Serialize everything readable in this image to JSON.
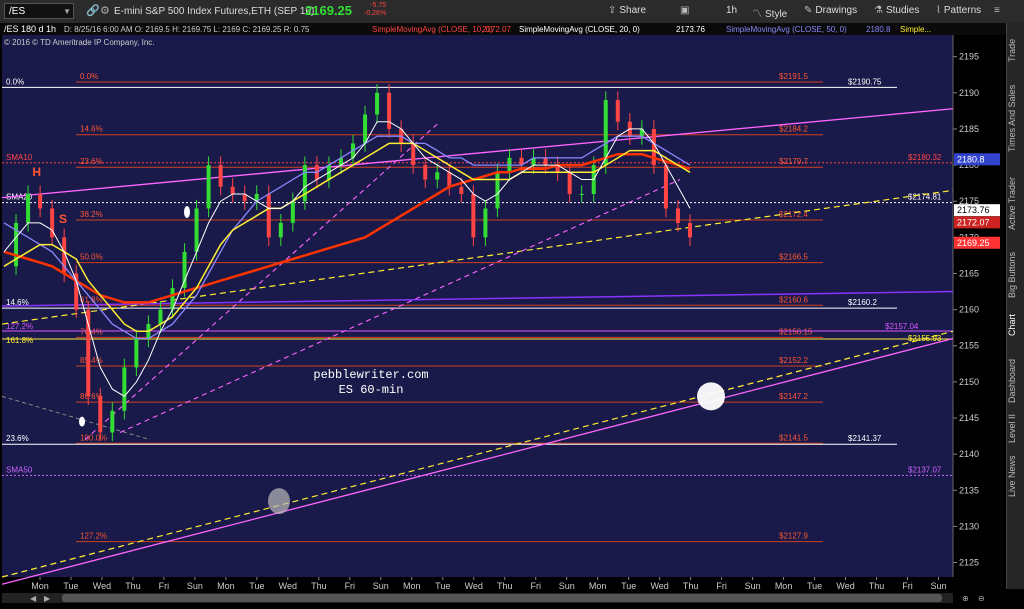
{
  "toolbar": {
    "symbol": "/ES",
    "title": "E-mini S&P 500 Index Futures,ETH (SEP 16)",
    "price": "2169.25",
    "change": "-5.75",
    "change_pct": "-0.26%",
    "share": "Share",
    "interval": "1h",
    "style": "Style",
    "drawings": "Drawings",
    "studies": "Studies",
    "patterns": "Patterns"
  },
  "info_bar": {
    "chart_id": "/ES 180 d 1h",
    "copyright": "© 2016 © TD Ameritrade IP Company, Inc.",
    "ohlc": "D: 8/25/16 6:00 AM  O: 2169.5  H: 2169.75  L: 2169  C: 2169.25  R: 0.75",
    "sma10_label": "SimpleMovingAvg (CLOSE, 10, 0)",
    "sma10_value": "2172.07",
    "sma20_label": "SimpleMovingAvg (CLOSE, 20, 0)",
    "sma20_value": "2173.76",
    "sma50_label": "SimpleMovingAvg (CLOSE, 50, 0)",
    "sma50_value": "2180.8",
    "more": "Simple..."
  },
  "side_tabs": [
    "Trade",
    "Times And Sales",
    "Active Trader",
    "Big Buttons",
    "Chart",
    "Dashboard",
    "Level II",
    "Live News"
  ],
  "colors": {
    "background": "#1a1a4a",
    "fib_line": "#d04020",
    "sma10": "#ffffff",
    "sma20": "#ffee33",
    "sma50": "#8888ff",
    "sma_long": "#ff3300",
    "trend_magenta": "#ff66ff",
    "trend_yellow": "#ffee33",
    "price_up": "#33dd33",
    "price_down": "#ff4444"
  },
  "chart_data": {
    "type": "line",
    "title": "pebblewriter.com",
    "subtitle": "ES 60-min",
    "ylim": [
      2123,
      2198
    ],
    "y_ticks": [
      2125,
      2130,
      2135,
      2140,
      2145,
      2150,
      2155,
      2160,
      2165,
      2170,
      2175,
      2180,
      2185,
      2190,
      2195
    ],
    "x_labels": [
      "Mon",
      "Tue",
      "Wed",
      "Thu",
      "Fri",
      "Sun",
      "Mon",
      "Tue",
      "Wed",
      "Thu",
      "Fri",
      "Sun",
      "Mon",
      "Tue",
      "Wed",
      "Thu",
      "Fri",
      "Sun",
      "Mon",
      "Tue",
      "Wed",
      "Thu",
      "Fri",
      "Sun",
      "Mon",
      "Tue",
      "Wed",
      "Thu",
      "Fri",
      "Sun"
    ],
    "fib_levels": [
      {
        "pct": "0.0%",
        "price": "$2191.5",
        "y": 2191.5
      },
      {
        "pct": "14.6%",
        "price": "$2184.2",
        "y": 2184.2
      },
      {
        "pct": "23.6%",
        "price": "$2179.7",
        "y": 2179.7
      },
      {
        "pct": "38.2%",
        "price": "$2172.4",
        "y": 2172.4
      },
      {
        "pct": "50.0%",
        "price": "$2166.5",
        "y": 2166.5
      },
      {
        "pct": "61.8%",
        "price": "$2160.6",
        "y": 2160.6
      },
      {
        "pct": "76.4%",
        "price": "$2156.15",
        "y": 2156.15
      },
      {
        "pct": "85.4%",
        "price": "$2152.2",
        "y": 2152.2
      },
      {
        "pct": "88.6%",
        "price": "$2147.2",
        "y": 2147.2
      },
      {
        "pct": "100.0%",
        "price": "$2141.5",
        "y": 2141.5
      },
      {
        "pct": "127.2%",
        "price": "$2127.9",
        "y": 2127.9
      }
    ],
    "white_levels": [
      {
        "left_label": "0.0%",
        "price": "$2190.75",
        "y": 2190.75
      },
      {
        "left_label": "14.6%",
        "price": "$2160.2",
        "y": 2160.2
      },
      {
        "left_label": "23.6%",
        "price": "$2141.37",
        "y": 2141.37
      }
    ],
    "dashed_levels": [
      {
        "label": "SMA10",
        "price": "$2180.32",
        "y": 2180.32,
        "color": "#ff4444"
      },
      {
        "label": "SMA20",
        "price": "$2174.81",
        "y": 2174.81,
        "color": "#ffffff"
      },
      {
        "label": "SMA50",
        "price": "$2137.07",
        "y": 2137.07,
        "color": "#cc66ff"
      }
    ],
    "extra_levels": [
      {
        "label": "127.2%",
        "price": "$2157.04",
        "y": 2157.04,
        "color": "#dd55ff"
      },
      {
        "label": "161.8%",
        "price": "$2155.93",
        "y": 2155.93,
        "color": "#ffee33"
      }
    ],
    "price_tags": [
      {
        "value": "2180.8",
        "y": 2180.8,
        "bg": "#3344cc",
        "fg": "#ffffff"
      },
      {
        "value": "2173.76",
        "y": 2173.76,
        "bg": "#ffffff",
        "fg": "#000000"
      },
      {
        "value": "2172.07",
        "y": 2172.07,
        "bg": "#cc2222",
        "fg": "#ffffff"
      },
      {
        "value": "2169.25",
        "y": 2169.25,
        "bg": "#ff3333",
        "fg": "#ffffff"
      }
    ],
    "pattern_labels": [
      {
        "text": "H",
        "x": 0.032,
        "y": 2178.5
      },
      {
        "text": "S",
        "x": 0.06,
        "y": 2172.0
      }
    ],
    "close_series": [
      2166,
      2172,
      2176,
      2174,
      2170,
      2165,
      2160,
      2148,
      2143,
      2146,
      2152,
      2156,
      2158,
      2160,
      2163,
      2168,
      2174,
      2180,
      2177,
      2176,
      2175,
      2176,
      2170,
      2172,
      2175,
      2180,
      2178,
      2180,
      2181,
      2183,
      2187,
      2190,
      2185,
      2183,
      2180,
      2178,
      2179,
      2177,
      2176,
      2170,
      2174,
      2179,
      2181,
      2180,
      2181,
      2180,
      2179,
      2176,
      2176,
      2180,
      2189,
      2186,
      2184,
      2185,
      2180,
      2174,
      2172,
      2170
    ],
    "sma10_series": [
      2168,
      2170,
      2172,
      2172,
      2171,
      2168,
      2164,
      2158,
      2152,
      2149,
      2148,
      2150,
      2153,
      2157,
      2160,
      2164,
      2168,
      2172,
      2175,
      2176,
      2176,
      2175,
      2174,
      2174,
      2175,
      2177,
      2178,
      2179,
      2180,
      2181,
      2183,
      2186,
      2186,
      2185,
      2183,
      2181,
      2180,
      2179,
      2178,
      2176,
      2175,
      2176,
      2178,
      2179,
      2180,
      2180,
      2180,
      2179,
      2178,
      2178,
      2181,
      2184,
      2185,
      2185,
      2183,
      2180,
      2177,
      2174
    ],
    "sma20_series": [
      2166,
      2167,
      2168,
      2169,
      2169,
      2168,
      2167,
      2164,
      2162,
      2160,
      2158,
      2157,
      2157,
      2158,
      2159,
      2161,
      2163,
      2166,
      2169,
      2171,
      2172,
      2173,
      2174,
      2174,
      2175,
      2176,
      2177,
      2178,
      2179,
      2180,
      2181,
      2182,
      2183,
      2183,
      2183,
      2182,
      2181,
      2180,
      2179,
      2178,
      2178,
      2178,
      2178,
      2179,
      2179,
      2179,
      2179,
      2179,
      2179,
      2179,
      2180,
      2181,
      2182,
      2182,
      2182,
      2181,
      2180,
      2179
    ],
    "sma50_series": [
      2172,
      2171,
      2170,
      2169,
      2168,
      2166,
      2164,
      2162,
      2160,
      2158,
      2157,
      2156,
      2156,
      2157,
      2158,
      2160,
      2162,
      2165,
      2168,
      2171,
      2173,
      2175,
      2176,
      2177,
      2178,
      2179,
      2179,
      2180,
      2181,
      2182,
      2183,
      2184,
      2184,
      2184,
      2183,
      2183,
      2182,
      2181,
      2181,
      2180,
      2180,
      2180,
      2180,
      2180,
      2181,
      2181,
      2181,
      2181,
      2181,
      2182,
      2183,
      2184,
      2184,
      2184,
      2183,
      2182,
      2181,
      2180
    ],
    "sma_long_series": [
      2168,
      2167.5,
      2167,
      2166.5,
      2166,
      2165,
      2164,
      2163,
      2162,
      2161.5,
      2161,
      2161,
      2161,
      2161.5,
      2162,
      2162.5,
      2163,
      2163.5,
      2164,
      2164.5,
      2165,
      2165.5,
      2166,
      2166.5,
      2167,
      2167.5,
      2168,
      2168.5,
      2169,
      2169.5,
      2170,
      2171,
      2172,
      2173,
      2174,
      2175,
      2176,
      2177,
      2177.5,
      2178,
      2178.5,
      2179,
      2179,
      2179.5,
      2179.5,
      2179.5,
      2180,
      2180,
      2180,
      2180.5,
      2181,
      2181.5,
      2181.5,
      2181.5,
      2181,
      2180.5,
      2180,
      2179.5
    ]
  }
}
